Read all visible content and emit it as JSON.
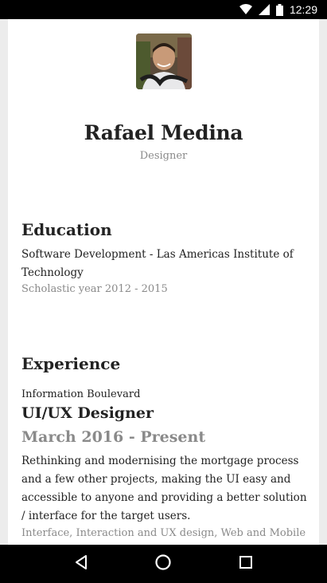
{
  "status_bar": {
    "time": "12:29",
    "icons": [
      "wifi-icon",
      "signal-icon",
      "battery-icon"
    ]
  },
  "profile": {
    "name": "Rafael Medina",
    "role": "Designer",
    "avatar": "profile-photo"
  },
  "education": {
    "heading": "Education",
    "program": "Software Development - Las Americas Institute of Technology",
    "years": "Scholastic year 2012 - 2015"
  },
  "experience": {
    "heading": "Experience",
    "company": "Information Boulevard",
    "title": "UI/UX Designer",
    "dates": "March 2016 - Present",
    "description": "Rethinking and modernising the mortgage process and a few other projects, making the UI easy and accessible to anyone and providing a better solution / interface for the target users.",
    "tags": "Interface, Interaction and UX design, Web and Mobile"
  },
  "nav_bar": {
    "buttons": [
      "back-icon",
      "home-icon",
      "recents-icon"
    ]
  }
}
